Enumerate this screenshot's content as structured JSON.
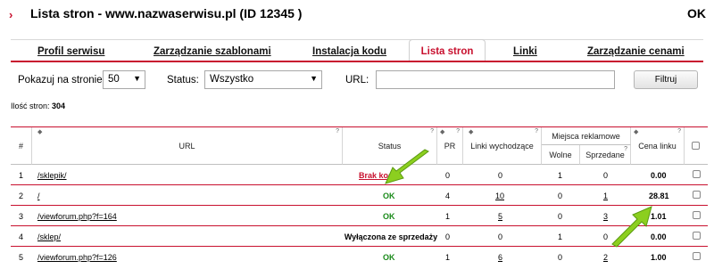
{
  "header": {
    "chevron": "›",
    "title": "Lista stron - www.nazwaserwisu.pl (ID 12345 )",
    "ok": "OK"
  },
  "tabs": [
    {
      "label": "Profil serwisu",
      "active": false
    },
    {
      "label": "Zarządzanie szablonami",
      "active": false
    },
    {
      "label": "Instalacja kodu",
      "active": false
    },
    {
      "label": "Lista stron",
      "active": true
    },
    {
      "label": "Linki",
      "active": false
    },
    {
      "label": "Zarządzanie cenami",
      "active": false
    }
  ],
  "filters": {
    "per_page_label": "Pokazuj na stronie:",
    "per_page_value": "50",
    "status_label": "Status:",
    "status_value": "Wszystko",
    "url_label": "URL:",
    "url_value": "",
    "filter_button": "Filtruj"
  },
  "count": {
    "label": "Ilość stron:",
    "value": "304"
  },
  "table": {
    "headers": {
      "num": "#",
      "url": "URL",
      "status": "Status",
      "pr": "PR",
      "outgoing": "Linki wychodzące",
      "ad_places": "Miejsca reklamowe",
      "free": "Wolne",
      "sold": "Sprzedane",
      "price": "Cena linku",
      "help": "?",
      "sort": "◆"
    },
    "rows": [
      {
        "num": "1",
        "url": "/sklepik/",
        "status": "Brak kodu",
        "status_type": "red",
        "pr": "0",
        "outgoing": "0",
        "outgoing_link": false,
        "free": "1",
        "sold": "0",
        "sold_link": false,
        "price": "0.00"
      },
      {
        "num": "2",
        "url": "/",
        "status": "OK",
        "status_type": "green",
        "pr": "4",
        "outgoing": "10",
        "outgoing_link": true,
        "free": "0",
        "sold": "1",
        "sold_link": true,
        "price": "28.81"
      },
      {
        "num": "3",
        "url": "/viewforum.php?f=164",
        "status": "OK",
        "status_type": "green",
        "pr": "1",
        "outgoing": "5",
        "outgoing_link": true,
        "free": "0",
        "sold": "3",
        "sold_link": true,
        "price": "1.01"
      },
      {
        "num": "4",
        "url": "/sklep/",
        "status": "Wyłączona ze sprzedaży",
        "status_type": "black",
        "pr": "0",
        "outgoing": "0",
        "outgoing_link": false,
        "free": "1",
        "sold": "0",
        "sold_link": false,
        "price": "0.00"
      },
      {
        "num": "5",
        "url": "/viewforum.php?f=126",
        "status": "OK",
        "status_type": "green",
        "pr": "1",
        "outgoing": "6",
        "outgoing_link": true,
        "free": "0",
        "sold": "2",
        "sold_link": true,
        "price": "1.00"
      }
    ]
  },
  "colors": {
    "accent": "#c8102e",
    "ok_green": "#1a8a1a",
    "arrow_green": "#8ccf1f"
  }
}
